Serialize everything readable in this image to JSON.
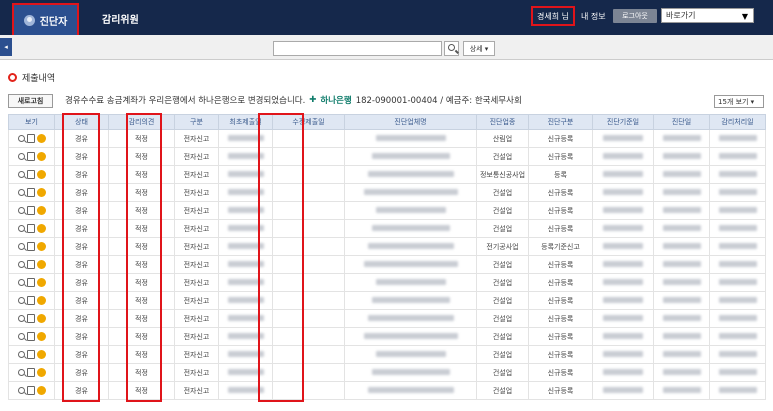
{
  "header": {
    "active_tab": "진단자",
    "tab2": "감리위원",
    "user_name": "경세희 님",
    "my_info": "내 정보",
    "logout": "로그아웃",
    "goto_select": "바로가기"
  },
  "search": {
    "value": "",
    "detail_label": "상세 ▾"
  },
  "section": {
    "title": "제출내역",
    "refresh": "새로고침",
    "notice": "경유수수료 송금계좌가 우리은행에서 하나은행으로 변경되었습니다.",
    "bank_name": "하나은행",
    "account": "182-090001-00404 / 예금주: 한국세무사회",
    "per_page": "15개 보기 ▾"
  },
  "table": {
    "headers": [
      "보기",
      "상태",
      "감리의견",
      "구분",
      "최초제출일",
      "수정제출일",
      "진단업체명",
      "진단업종",
      "진단구분",
      "진단기준일",
      "진단일",
      "감리처리일"
    ],
    "rows": [
      {
        "status": "경유",
        "opinion": "적정",
        "type": "전자신고",
        "industry": "산림업",
        "category": "신규등록"
      },
      {
        "status": "경유",
        "opinion": "적정",
        "type": "전자신고",
        "industry": "건설업",
        "category": "신규등록"
      },
      {
        "status": "경유",
        "opinion": "적정",
        "type": "전자신고",
        "industry": "정보통신공사업",
        "category": "등록"
      },
      {
        "status": "경유",
        "opinion": "적정",
        "type": "전자신고",
        "industry": "건설업",
        "category": "신규등록"
      },
      {
        "status": "경유",
        "opinion": "적정",
        "type": "전자신고",
        "industry": "건설업",
        "category": "신규등록"
      },
      {
        "status": "경유",
        "opinion": "적정",
        "type": "전자신고",
        "industry": "건설업",
        "category": "신규등록"
      },
      {
        "status": "경유",
        "opinion": "적정",
        "type": "전자신고",
        "industry": "전기공사업",
        "category": "등록기준신고"
      },
      {
        "status": "경유",
        "opinion": "적정",
        "type": "전자신고",
        "industry": "건설업",
        "category": "신규등록"
      },
      {
        "status": "경유",
        "opinion": "적정",
        "type": "전자신고",
        "industry": "건설업",
        "category": "신규등록"
      },
      {
        "status": "경유",
        "opinion": "적정",
        "type": "전자신고",
        "industry": "건설업",
        "category": "신규등록"
      },
      {
        "status": "경유",
        "opinion": "적정",
        "type": "전자신고",
        "industry": "건설업",
        "category": "신규등록"
      },
      {
        "status": "경유",
        "opinion": "적정",
        "type": "전자신고",
        "industry": "건설업",
        "category": "신규등록"
      },
      {
        "status": "경유",
        "opinion": "적정",
        "type": "전자신고",
        "industry": "건설업",
        "category": "신규등록"
      },
      {
        "status": "경유",
        "opinion": "적정",
        "type": "전자신고",
        "industry": "건설업",
        "category": "신규등록"
      },
      {
        "status": "경유",
        "opinion": "적정",
        "type": "전자신고",
        "industry": "건설업",
        "category": "신규등록"
      }
    ]
  },
  "colors": {
    "topbar": "#15284b",
    "active_tab": "#2b4f8f",
    "highlight": "#e0141a",
    "header_row": "#dfe7f3"
  }
}
